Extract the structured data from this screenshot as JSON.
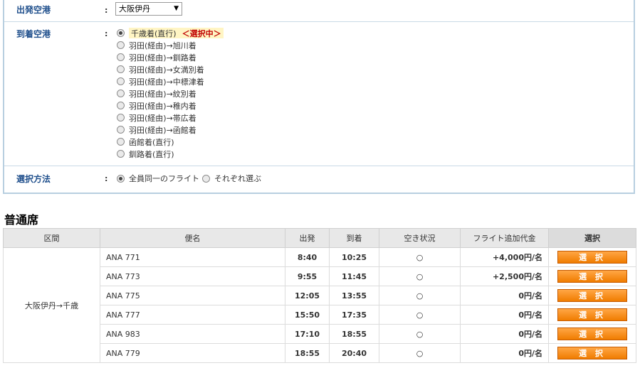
{
  "departure": {
    "label": "出発空港",
    "selected": "大阪伊丹"
  },
  "arrival": {
    "label": "到着空港",
    "selected_tag": "＜選択中＞",
    "options": [
      "千歳着(直行)",
      "羽田(経由)→旭川着",
      "羽田(経由)→釧路着",
      "羽田(経由)→女満別着",
      "羽田(経由)→中標津着",
      "羽田(経由)→紋別着",
      "羽田(経由)→稚内着",
      "羽田(経由)→帯広着",
      "羽田(経由)→函館着",
      "函館着(直行)",
      "釧路着(直行)"
    ]
  },
  "method": {
    "label": "選択方法",
    "options": [
      "全員同一のフライト",
      "それぞれ選ぶ"
    ]
  },
  "section_title": "普通席",
  "table": {
    "headers": [
      "区間",
      "便名",
      "出発",
      "到着",
      "空き状況",
      "フライト追加代金",
      "選択"
    ],
    "route": "大阪伊丹→千歳",
    "rows": [
      {
        "flight": "ANA 771",
        "dep": "8:40",
        "arr": "10:25",
        "avail": "○",
        "price": "+4,000円/名",
        "button": "選 択"
      },
      {
        "flight": "ANA 773",
        "dep": "9:55",
        "arr": "11:45",
        "avail": "○",
        "price": "+2,500円/名",
        "button": "選 択"
      },
      {
        "flight": "ANA 775",
        "dep": "12:05",
        "arr": "13:55",
        "avail": "○",
        "price": "0円/名",
        "button": "選 択"
      },
      {
        "flight": "ANA 777",
        "dep": "15:50",
        "arr": "17:35",
        "avail": "○",
        "price": "0円/名",
        "button": "選 択"
      },
      {
        "flight": "ANA 983",
        "dep": "17:10",
        "arr": "18:55",
        "avail": "○",
        "price": "0円/名",
        "button": "選 択"
      },
      {
        "flight": "ANA 779",
        "dep": "18:55",
        "arr": "20:40",
        "avail": "○",
        "price": "0円/名",
        "button": "選 択"
      }
    ]
  }
}
